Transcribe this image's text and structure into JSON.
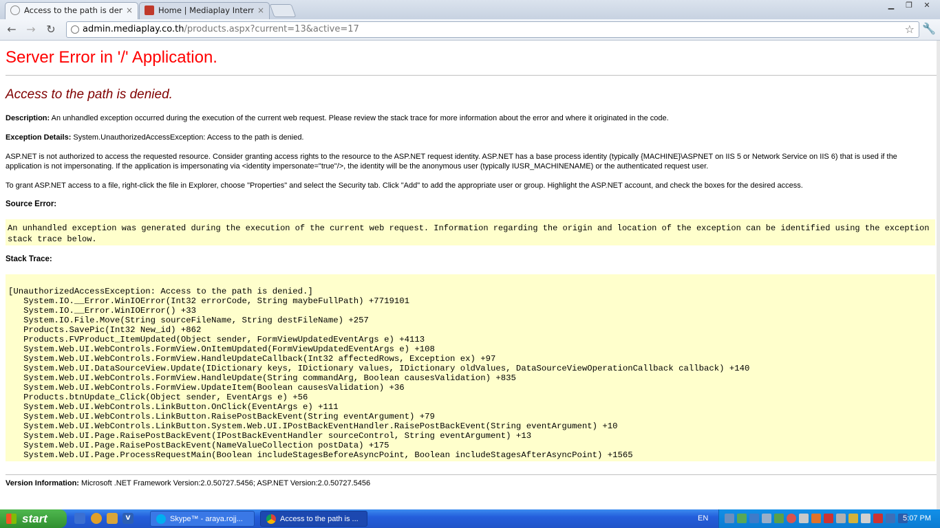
{
  "browser": {
    "tabs": [
      {
        "title": "Access to the path is denied.",
        "active": true,
        "icon": "page-icon"
      },
      {
        "title": "Home | Mediaplay Internation",
        "active": false,
        "icon": "mediaplay-icon"
      }
    ],
    "close_glyph": "×",
    "url_host": "admin.mediaplay.co.th",
    "url_path": "/products.aspx?current=13&active=17"
  },
  "page": {
    "title": "Server Error in '/' Application.",
    "error_title": "Access to the path is denied.",
    "description_label": "Description:",
    "description_text": "An unhandled exception occurred during the execution of the current web request. Please review the stack trace for more information about the error and where it originated in the code.",
    "exception_label": "Exception Details:",
    "exception_text": "System.UnauthorizedAccessException: Access to the path is denied.",
    "aspnet_paragraph": "ASP.NET is not authorized to access the requested resource. Consider granting access rights to the resource to the ASP.NET request identity. ASP.NET has a base process identity (typically {MACHINE}\\ASPNET on IIS 5 or Network Service on IIS 6) that is used if the application is not impersonating. If the application is impersonating via <identity impersonate=\"true\"/>, the identity will be the anonymous user (typically IUSR_MACHINENAME) or the authenticated request user.",
    "grant_paragraph": "To grant ASP.NET access to a file, right-click the file in Explorer, choose \"Properties\" and select the Security tab. Click \"Add\" to add the appropriate user or group. Highlight the ASP.NET account, and check the boxes for the desired access.",
    "source_error_label": "Source Error:",
    "source_error_text": "An unhandled exception was generated during the execution of the current web request. Information regarding the origin and location of the exception can be identified using the exception stack trace below.",
    "stack_trace_label": "Stack Trace:",
    "stack_trace": "[UnauthorizedAccessException: Access to the path is denied.]\n   System.IO.__Error.WinIOError(Int32 errorCode, String maybeFullPath) +7719101\n   System.IO.__Error.WinIOError() +33\n   System.IO.File.Move(String sourceFileName, String destFileName) +257\n   Products.SavePic(Int32 New_id) +862\n   Products.FVProduct_ItemUpdated(Object sender, FormViewUpdatedEventArgs e) +4113\n   System.Web.UI.WebControls.FormView.OnItemUpdated(FormViewUpdatedEventArgs e) +108\n   System.Web.UI.WebControls.FormView.HandleUpdateCallback(Int32 affectedRows, Exception ex) +97\n   System.Web.UI.DataSourceView.Update(IDictionary keys, IDictionary values, IDictionary oldValues, DataSourceViewOperationCallback callback) +140\n   System.Web.UI.WebControls.FormView.HandleUpdate(String commandArg, Boolean causesValidation) +835\n   System.Web.UI.WebControls.FormView.UpdateItem(Boolean causesValidation) +36\n   Products.btnUpdate_Click(Object sender, EventArgs e) +56\n   System.Web.UI.WebControls.LinkButton.OnClick(EventArgs e) +111\n   System.Web.UI.WebControls.LinkButton.RaisePostBackEvent(String eventArgument) +79\n   System.Web.UI.WebControls.LinkButton.System.Web.UI.IPostBackEventHandler.RaisePostBackEvent(String eventArgument) +10\n   System.Web.UI.Page.RaisePostBackEvent(IPostBackEventHandler sourceControl, String eventArgument) +13\n   System.Web.UI.Page.RaisePostBackEvent(NameValueCollection postData) +175\n   System.Web.UI.Page.ProcessRequestMain(Boolean includeStagesBeforeAsyncPoint, Boolean includeStagesAfterAsyncPoint) +1565",
    "version_label": "Version Information:",
    "version_text": "Microsoft .NET Framework Version:2.0.50727.5456; ASP.NET Version:2.0.50727.5456"
  },
  "taskbar": {
    "start_label": "start",
    "buttons": [
      {
        "label": "Skype™ - araya.rojj...",
        "icon": "skype-icon"
      },
      {
        "label": "Access to the path is ...",
        "icon": "chrome-icon"
      }
    ],
    "language": "EN",
    "clock": "5:07 PM"
  },
  "colors": {
    "error_heading": "#ff0000",
    "error_title": "#800000",
    "code_background": "#ffffcc",
    "taskbar": "#245edb",
    "start_button": "#3c9a3c"
  }
}
